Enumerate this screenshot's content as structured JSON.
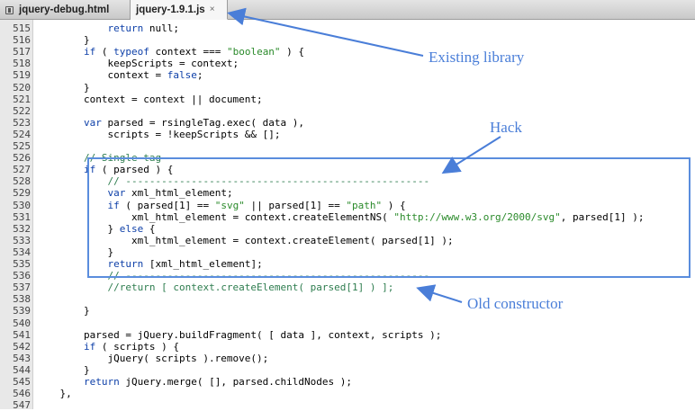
{
  "tabs": [
    {
      "label": "jquery-debug.html",
      "active": false
    },
    {
      "label": "jquery-1.9.1.js",
      "active": true,
      "close": "×"
    }
  ],
  "colors": {
    "annotation": "#4a7ed8",
    "keyword": "#0d3fa8",
    "string": "#2a8a2a",
    "comment": "#2e7d4f"
  },
  "annotations": {
    "existing_library": "Existing library",
    "hack": "Hack",
    "old_constructor": "Old constructor"
  },
  "code_lines": [
    {
      "n": "515",
      "parts": [
        [
          "            ",
          ""
        ],
        [
          "return",
          "kw"
        ],
        [
          " null;",
          ""
        ]
      ]
    },
    {
      "n": "516",
      "parts": [
        [
          "        }",
          ""
        ]
      ]
    },
    {
      "n": "517",
      "parts": [
        [
          "        ",
          ""
        ],
        [
          "if",
          "kw"
        ],
        [
          " ( ",
          ""
        ],
        [
          "typeof",
          "kw"
        ],
        [
          " context === ",
          ""
        ],
        [
          "\"boolean\"",
          "str"
        ],
        [
          " ) {",
          ""
        ]
      ]
    },
    {
      "n": "518",
      "parts": [
        [
          "            keepScripts = context;",
          ""
        ]
      ]
    },
    {
      "n": "519",
      "parts": [
        [
          "            context = ",
          ""
        ],
        [
          "false",
          "kw"
        ],
        [
          ";",
          ""
        ]
      ]
    },
    {
      "n": "520",
      "parts": [
        [
          "        }",
          ""
        ]
      ]
    },
    {
      "n": "521",
      "parts": [
        [
          "        context = context || document;",
          ""
        ]
      ]
    },
    {
      "n": "522",
      "parts": [
        [
          "",
          ""
        ]
      ]
    },
    {
      "n": "523",
      "parts": [
        [
          "        ",
          ""
        ],
        [
          "var",
          "kw"
        ],
        [
          " parsed = rsingleTag.exec( data ),",
          ""
        ]
      ]
    },
    {
      "n": "524",
      "parts": [
        [
          "            scripts = !keepScripts && [];",
          ""
        ]
      ]
    },
    {
      "n": "525",
      "parts": [
        [
          "",
          ""
        ]
      ]
    },
    {
      "n": "526",
      "parts": [
        [
          "        ",
          ""
        ],
        [
          "// Single tag",
          "cm"
        ]
      ]
    },
    {
      "n": "527",
      "parts": [
        [
          "        ",
          ""
        ],
        [
          "if",
          "kw"
        ],
        [
          " ( parsed ) {",
          ""
        ]
      ]
    },
    {
      "n": "528",
      "parts": [
        [
          "            ",
          ""
        ],
        [
          "// ---------------------------------------------------",
          "cm"
        ]
      ]
    },
    {
      "n": "529",
      "parts": [
        [
          "            ",
          ""
        ],
        [
          "var",
          "kw"
        ],
        [
          " xml_html_element;",
          ""
        ]
      ]
    },
    {
      "n": "530",
      "parts": [
        [
          "            ",
          ""
        ],
        [
          "if",
          "kw"
        ],
        [
          " ( parsed[1] == ",
          ""
        ],
        [
          "\"svg\"",
          "str"
        ],
        [
          " || parsed[1] == ",
          ""
        ],
        [
          "\"path\"",
          "str"
        ],
        [
          " ) {",
          ""
        ]
      ]
    },
    {
      "n": "531",
      "parts": [
        [
          "                xml_html_element = context.createElementNS( ",
          ""
        ],
        [
          "\"http://www.w3.org/2000/svg\"",
          "str"
        ],
        [
          ", parsed[1] );",
          ""
        ]
      ]
    },
    {
      "n": "532",
      "parts": [
        [
          "            } ",
          ""
        ],
        [
          "else",
          "kw"
        ],
        [
          " {",
          ""
        ]
      ]
    },
    {
      "n": "533",
      "parts": [
        [
          "                xml_html_element = context.createElement( parsed[1] );",
          ""
        ]
      ]
    },
    {
      "n": "534",
      "parts": [
        [
          "            }",
          ""
        ]
      ]
    },
    {
      "n": "535",
      "parts": [
        [
          "            ",
          ""
        ],
        [
          "return",
          "kw"
        ],
        [
          " [xml_html_element];",
          ""
        ]
      ]
    },
    {
      "n": "536",
      "parts": [
        [
          "            ",
          ""
        ],
        [
          "// ---------------------------------------------------",
          "cm"
        ]
      ]
    },
    {
      "n": "537",
      "parts": [
        [
          "            ",
          ""
        ],
        [
          "//return [ context.createElement( parsed[1] ) ];",
          "cm"
        ]
      ]
    },
    {
      "n": "538",
      "parts": [
        [
          "",
          ""
        ]
      ]
    },
    {
      "n": "539",
      "parts": [
        [
          "        }",
          ""
        ]
      ]
    },
    {
      "n": "540",
      "parts": [
        [
          "",
          ""
        ]
      ]
    },
    {
      "n": "541",
      "parts": [
        [
          "        parsed = jQuery.buildFragment( [ data ], context, scripts );",
          ""
        ]
      ]
    },
    {
      "n": "542",
      "parts": [
        [
          "        ",
          ""
        ],
        [
          "if",
          "kw"
        ],
        [
          " ( scripts ) {",
          ""
        ]
      ]
    },
    {
      "n": "543",
      "parts": [
        [
          "            jQuery( scripts ).remove();",
          ""
        ]
      ]
    },
    {
      "n": "544",
      "parts": [
        [
          "        }",
          ""
        ]
      ]
    },
    {
      "n": "545",
      "parts": [
        [
          "        ",
          ""
        ],
        [
          "return",
          "kw"
        ],
        [
          " jQuery.merge( [], parsed.childNodes );",
          ""
        ]
      ]
    },
    {
      "n": "546",
      "parts": [
        [
          "    },",
          ""
        ]
      ]
    },
    {
      "n": "547",
      "parts": [
        [
          "",
          ""
        ]
      ]
    }
  ]
}
